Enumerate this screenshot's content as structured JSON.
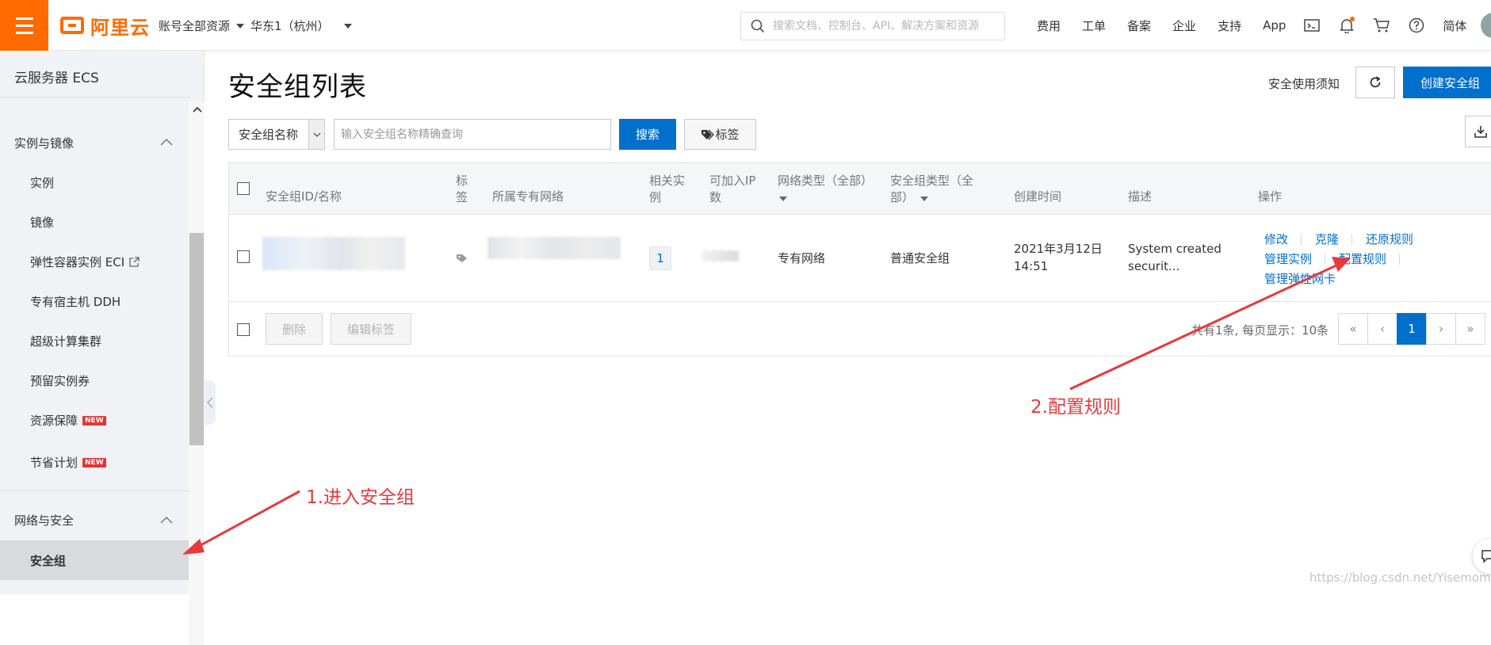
{
  "topbar": {
    "logo_text": "阿里云",
    "account_scope": "账号全部资源",
    "region": "华东1（杭州）",
    "search_placeholder": "搜索文档、控制台、API、解决方案和资源",
    "links": [
      "费用",
      "工单",
      "备案",
      "企业",
      "支持",
      "App"
    ],
    "lang": "简体",
    "brand_color": "#ff6a00"
  },
  "sidebar": {
    "title": "云服务器 ECS",
    "group1": "实例与镜像",
    "group1_items": [
      "实例",
      "镜像",
      "弹性容器实例 ECI",
      "专有宿主机 DDH",
      "超级计算集群",
      "预留实例券",
      "资源保障",
      "节省计划"
    ],
    "new_badge": "NEW",
    "group2": "网络与安全",
    "active_item": "安全组"
  },
  "main": {
    "title": "安全组列表",
    "notice": "安全使用须知",
    "create_button": "创建安全组",
    "filter_select": "安全组名称",
    "filter_placeholder": "输入安全组名称精确查询",
    "search_button": "搜索",
    "tag_button": "标签",
    "accent_color": "#0070cc"
  },
  "table": {
    "headers": {
      "id_name": "安全组ID/名称",
      "tag_l1": "标",
      "tag_l2": "签",
      "vpc": "所属专有网络",
      "related_l1": "相关实",
      "related_l2": "例",
      "ip_l1": "可加入IP",
      "ip_l2": "数",
      "net_type_l1": "网络类型（全部）",
      "sg_type_l1": "安全组类型（全",
      "sg_type_l2": "部）",
      "created": "创建时间",
      "desc": "描述",
      "ops": "操作"
    },
    "row": {
      "related_count": "1",
      "net_type": "专有网络",
      "sg_type": "普通安全组",
      "created_l1": "2021年3月12日",
      "created_l2": "14:51",
      "desc_l1": "System created",
      "desc_l2": "securit...",
      "ops": {
        "modify": "修改",
        "clone": "克隆",
        "restore": "还原规则",
        "manage_instances": "管理实例",
        "config_rules": "配置规则",
        "manage_eni": "管理弹性网卡"
      }
    },
    "footer": {
      "delete": "删除",
      "edit_tags": "编辑标签",
      "pager_info": "共有1条, 每页显示：10条",
      "pager": [
        "«",
        "‹",
        "1",
        "›",
        "»"
      ],
      "current_page": "1"
    }
  },
  "annotations": {
    "step1": "1.进入安全组",
    "step2": "2.配置规则",
    "color": "#e8393c"
  },
  "watermark": "https://blog.csdn.net/Yisemom"
}
